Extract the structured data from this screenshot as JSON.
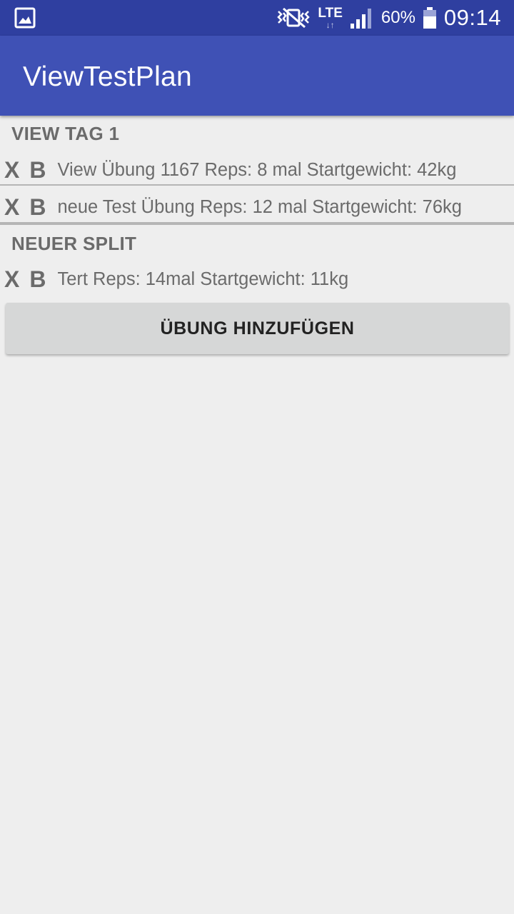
{
  "status_bar": {
    "lte_label": "LTE",
    "lte_arrows": "↓↑",
    "battery_percent": "60%",
    "time": "09:14",
    "icons": [
      "gallery-icon",
      "vibrate-icon",
      "signal-icon",
      "battery-icon"
    ]
  },
  "app_bar": {
    "title": "ViewTestPlan"
  },
  "sections": [
    {
      "header": "VIEW TAG 1",
      "rows": [
        {
          "x_label": "X",
          "b_label": "B",
          "text": "View Übung 1167 Reps: 8 mal Startgewicht: 42kg"
        },
        {
          "x_label": "X",
          "b_label": "B",
          "text": "neue Test Übung Reps: 12 mal Startgewicht: 76kg"
        }
      ]
    },
    {
      "header": "NEUER SPLIT",
      "rows": [
        {
          "x_label": "X",
          "b_label": "B",
          "text": "Tert Reps: 14mal Startgewicht: 11kg"
        }
      ]
    }
  ],
  "add_button": {
    "label": "ÜBUNG HINZUFÜGEN"
  },
  "colors": {
    "status_bar": "#2f3fa0",
    "app_bar": "#3f51b5",
    "background": "#eeeeee",
    "text_gray": "#6b6b6b",
    "button_bg": "#d6d7d7"
  }
}
